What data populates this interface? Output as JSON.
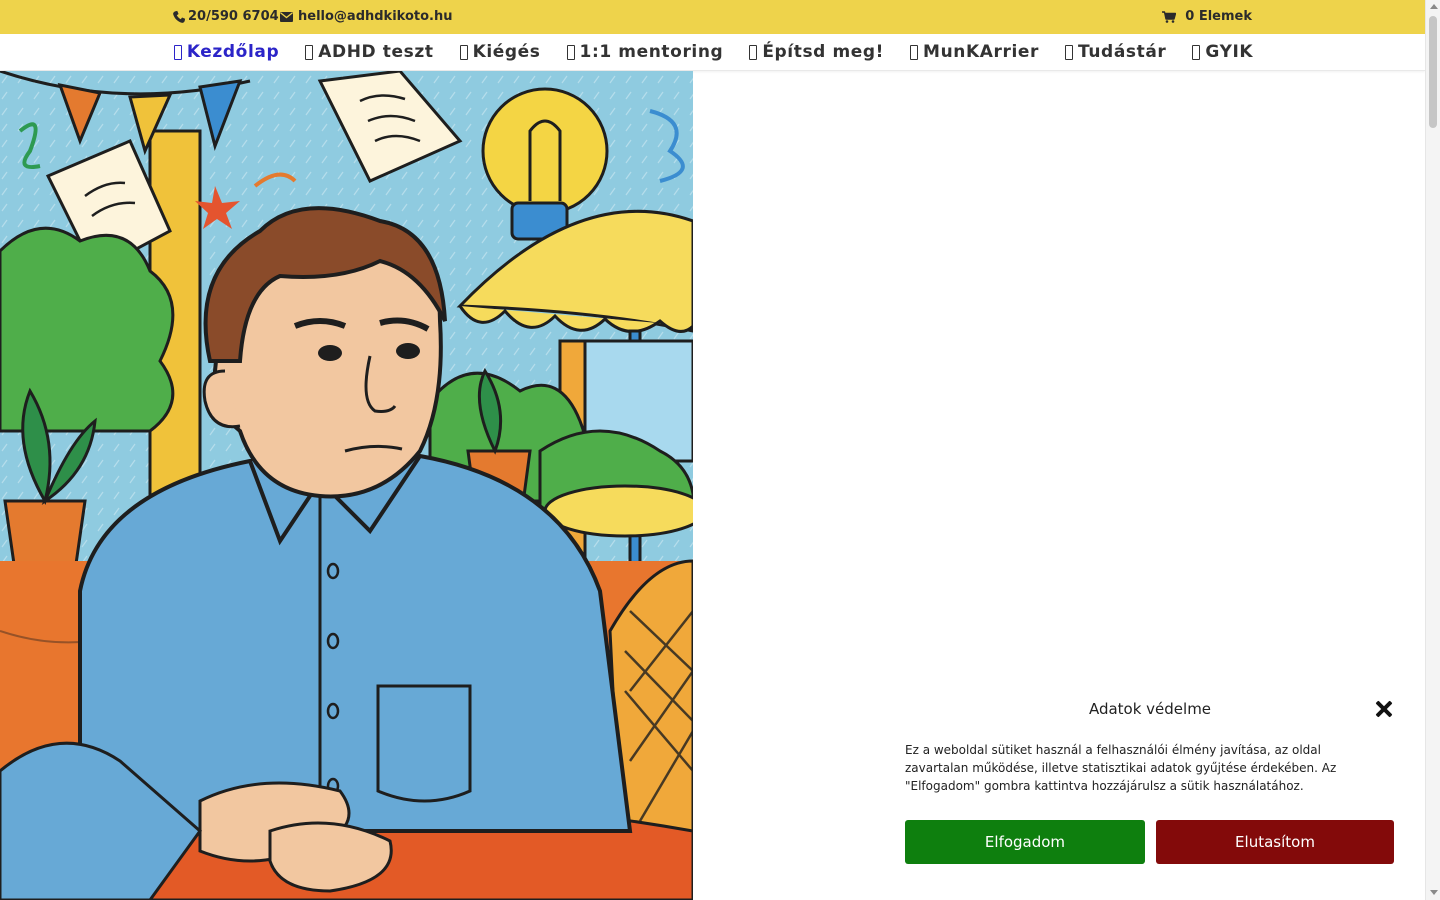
{
  "topbar": {
    "phone": "20/590 6704",
    "email": "hello@adhdkikoto.hu",
    "cart": "0 Elemek",
    "background": "#eed34b",
    "icons": [
      "phone-icon",
      "mail-icon",
      "cart-icon"
    ]
  },
  "nav": {
    "items": [
      {
        "label": "Kezdőlap",
        "active": true
      },
      {
        "label": "ADHD teszt"
      },
      {
        "label": "Kiégés"
      },
      {
        "label": "1:1 mentoring"
      },
      {
        "label": "Építsd meg!"
      },
      {
        "label": "MunKArrier"
      },
      {
        "label": "Tudástár"
      },
      {
        "label": "GYIK"
      }
    ],
    "active_color": "#2b24c8"
  },
  "cookie": {
    "title": "Adatok védelme",
    "text": "Ez a weboldal sütiket használ a felhasználói élmény javítása, az oldal zavartalan működése, illetve statisztikai adatok gyűjtése érdekében. Az \"Elfogadom\" gombra kattintva hozzájárulsz a sütik használatához.",
    "accept": "Elfogadom",
    "reject": "Elutasítom",
    "accept_color": "#0e7f0e",
    "reject_color": "#830a0a"
  }
}
